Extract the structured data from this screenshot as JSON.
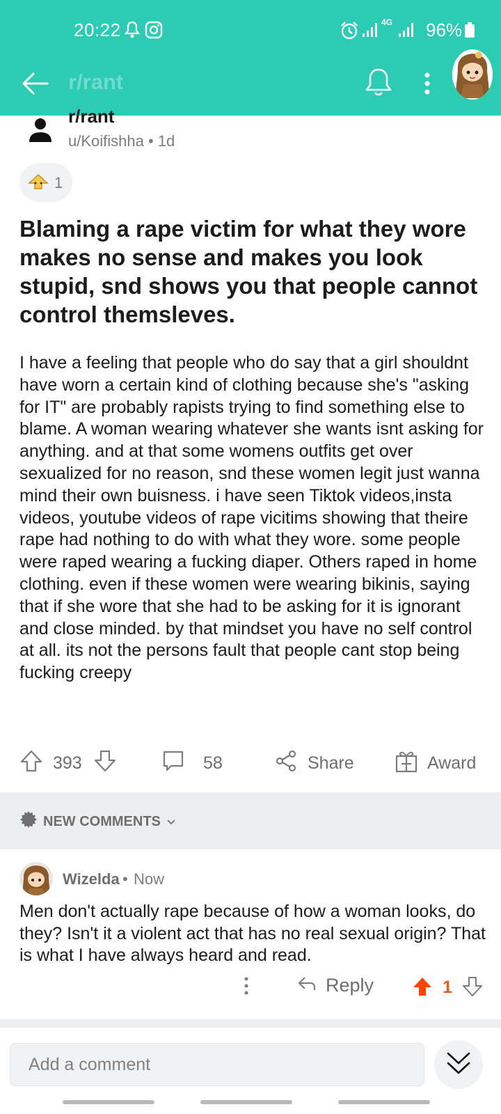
{
  "status_bar": {
    "time": "20:22",
    "battery": "96%",
    "network": "4G"
  },
  "header": {
    "subreddit": "r/rant",
    "icons": [
      "back-arrow-icon",
      "bell-icon",
      "more-vert-icon",
      "profile-avatar"
    ]
  },
  "post": {
    "subreddit": "r/rant",
    "author": "u/Koifishha",
    "age": "1d",
    "award_count": "1",
    "title": "Blaming a rape victim for what they wore makes no sense and makes you look stupid, snd shows you that people cannot control themsleves.",
    "body": "I have a feeling that people who do say that a girl shouldnt have worn  a certain kind of clothing because she's \"asking for IT\" are probably rapists trying to find something else to blame. A woman wearing whatever she wants isnt asking for anything. and at that some womens outfits get over sexualized for no reason, snd these women legit just wanna mind their own buisness. i have seen Tiktok videos,insta videos, youtube videos of rape vicitims showing that theire rape had nothing to do   with what they wore. some people were raped wearing a fucking diaper. Others raped in home clothing. even if these women were wearing bikinis, saying that if she wore that she had to be asking for it is ignorant and close minded. by that mindset you have no self control at all. its not the persons fault that people cant stop being fucking creepy",
    "score": "393",
    "comments": "58",
    "share_label": "Share",
    "award_label": "Award"
  },
  "comments_section": {
    "sort_label": "NEW COMMENTS"
  },
  "comment": {
    "author": "Wizelda",
    "separator": "•",
    "time": "Now",
    "body": "Men don't actually rape because of how a woman looks, do they? Isn't it a violent act that has no real sexual origin? That is what I have always heard and read.",
    "reply_label": "Reply",
    "score": "1"
  },
  "footer": {
    "placeholder": "Add a comment"
  },
  "colors": {
    "header_bg": "#2ccbb3",
    "upvote_active": "#ff4500"
  }
}
